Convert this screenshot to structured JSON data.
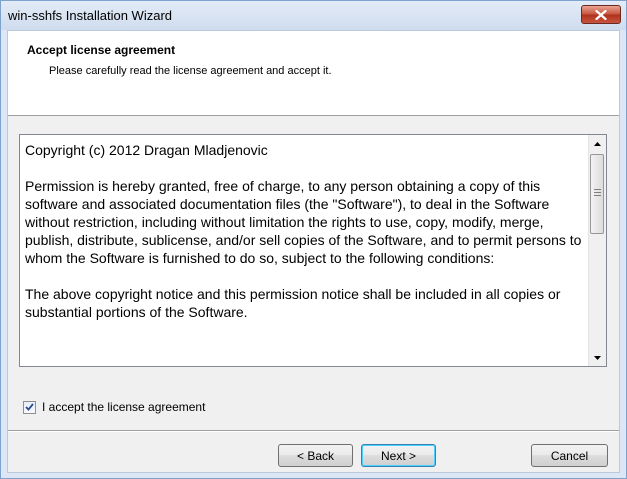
{
  "window": {
    "title": "win-sshfs Installation Wizard",
    "close_icon": "close-icon"
  },
  "header": {
    "title": "Accept license agreement",
    "subtitle": "Please carefully read the license agreement and accept it."
  },
  "license": {
    "paragraphs": [
      "Copyright (c) 2012 Dragan Mladjenovic",
      "Permission is hereby granted, free of charge, to any person obtaining a copy of this software and associated documentation files (the \"Software\"), to deal in the Software without restriction, including without limitation the rights to use, copy, modify, merge, publish, distribute, sublicense, and/or sell copies of the Software, and to permit persons to whom the Software is furnished to do so, subject to the following conditions:",
      "The above copyright notice and this permission notice shall be included in all copies or substantial portions of the Software."
    ]
  },
  "accept": {
    "label": "I accept the license agreement",
    "checked": true
  },
  "buttons": {
    "back": "< Back",
    "next": "Next >",
    "cancel": "Cancel"
  }
}
